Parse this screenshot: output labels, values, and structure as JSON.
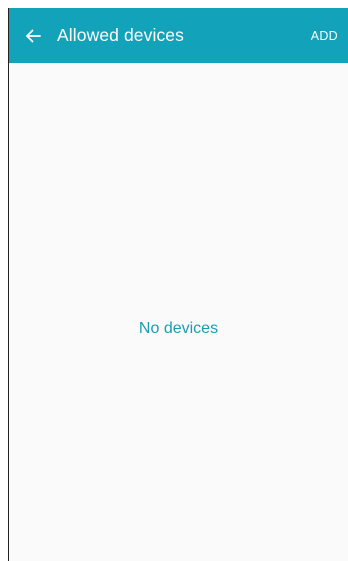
{
  "header": {
    "title": "Allowed devices",
    "add_label": "ADD"
  },
  "main": {
    "empty_text": "No devices"
  },
  "colors": {
    "appbar": "#12a3bb",
    "accent_text": "#1b9cb1",
    "background": "#fafafa"
  },
  "icons": {
    "back": "arrow-left-icon"
  }
}
